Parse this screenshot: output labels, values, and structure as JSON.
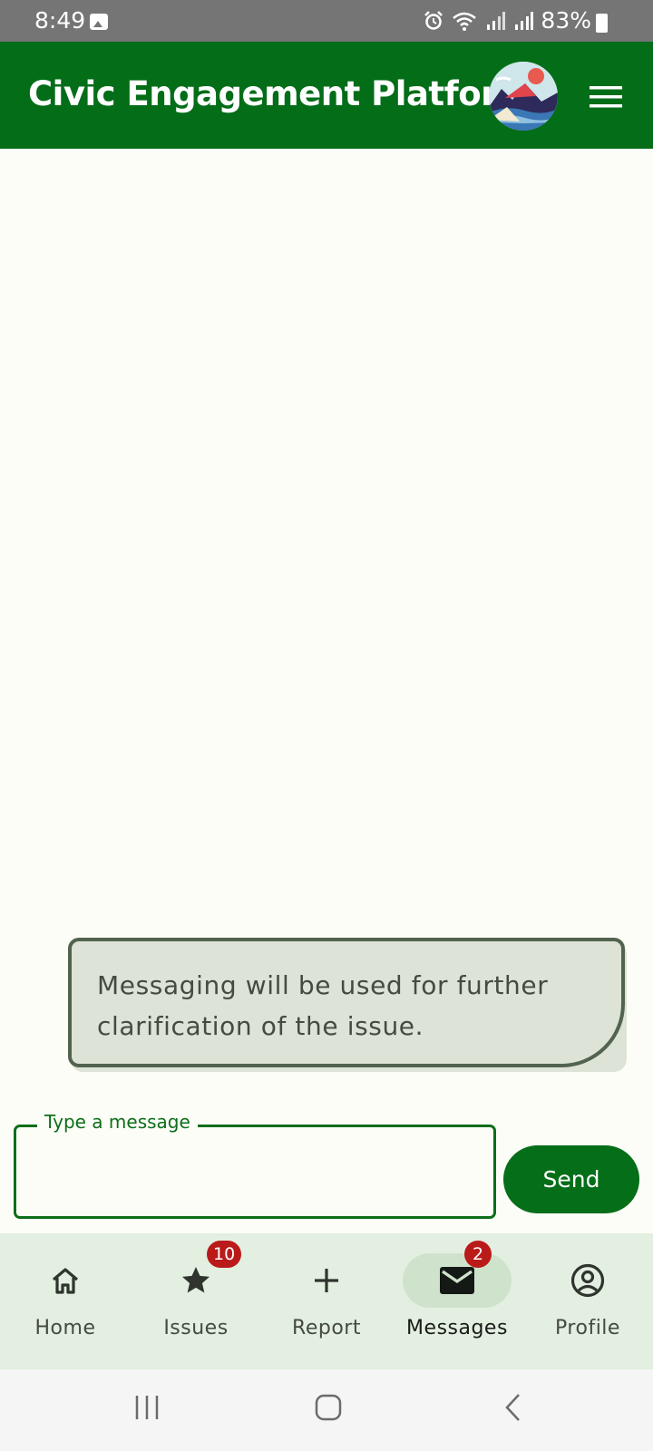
{
  "status_bar": {
    "time": "8:49",
    "battery": "83%",
    "icons": [
      "image-icon",
      "alarm-icon",
      "wifi-icon",
      "signal-icon",
      "signal-icon",
      "battery-icon"
    ]
  },
  "app_bar": {
    "title": "Civic Engagement Platform"
  },
  "chat": {
    "messages": [
      {
        "text": "Messaging will be used for further clarification of the issue."
      }
    ]
  },
  "composer": {
    "label": "Type a message",
    "value": "",
    "send_label": "Send"
  },
  "bottom_nav": {
    "items": [
      {
        "label": "Home",
        "icon": "home-icon"
      },
      {
        "label": "Issues",
        "icon": "star-icon",
        "badge": "10"
      },
      {
        "label": "Report",
        "icon": "plus-icon"
      },
      {
        "label": "Messages",
        "icon": "mail-icon",
        "badge": "2",
        "active": true
      },
      {
        "label": "Profile",
        "icon": "account-circle-icon"
      }
    ]
  },
  "colors": {
    "primary": "#046d18",
    "background": "#fcfdf6",
    "nav_background": "#e3efe0",
    "badge": "#ba1a1a",
    "bubble": "#dde3d6"
  }
}
